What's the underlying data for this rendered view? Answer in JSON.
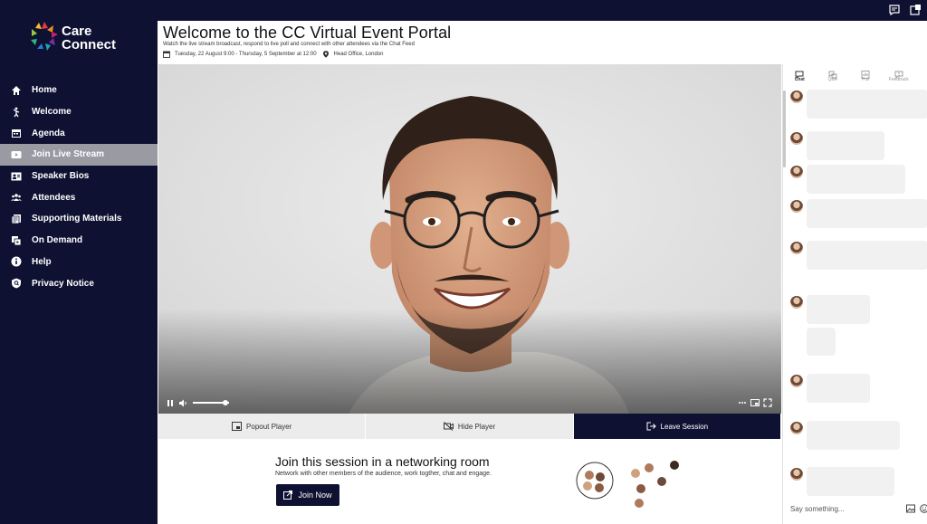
{
  "app": {
    "logo_line1": "Care",
    "logo_line2": "Connect",
    "colors": {
      "navy": "#0f1133",
      "active_nav": "#9a9aa3",
      "panel_grey": "#ececec",
      "chat_bubble": "#f1f1f1"
    }
  },
  "topbar": {
    "icons": [
      "chat-icon",
      "notification-icon"
    ]
  },
  "sidebar": {
    "items": [
      {
        "label": "Home",
        "icon": "home-icon"
      },
      {
        "label": "Welcome",
        "icon": "welcome-icon"
      },
      {
        "label": "Agenda",
        "icon": "calendar-icon"
      },
      {
        "label": "Join Live Stream",
        "icon": "play-icon",
        "active": true
      },
      {
        "label": "Speaker Bios",
        "icon": "speaker-bios-icon"
      },
      {
        "label": "Attendees",
        "icon": "attendees-icon"
      },
      {
        "label": "Supporting Materials",
        "icon": "documents-icon"
      },
      {
        "label": "On Demand",
        "icon": "on-demand-icon"
      },
      {
        "label": "Help",
        "icon": "info-icon"
      },
      {
        "label": "Privacy Notice",
        "icon": "privacy-icon"
      }
    ]
  },
  "header": {
    "title": "Welcome to the CC Virtual Event Portal",
    "subtitle": "Watch the live stream broadcast, respond to live poll and connect with other attendees via the Chat Feed",
    "date_range": "Tuesday, 22 August 9:00 - Thursday, 5 September at 12:00",
    "location": "Head Office, London"
  },
  "player": {
    "volume_level": 0.9,
    "popout_label": "Popout Player",
    "hide_label": "Hide Player",
    "leave_label": "Leave Session"
  },
  "networking": {
    "title": "Join this session in a networking room",
    "description": "Network with other members of the audience, work togther, chat and engage.",
    "join_label": "Join Now"
  },
  "chat": {
    "tabs": [
      {
        "label": "Chat",
        "icon": "chat-tab-icon",
        "active": true
      },
      {
        "label": "Q&A",
        "icon": "qa-tab-icon"
      },
      {
        "label": "Poll",
        "icon": "poll-tab-icon"
      },
      {
        "label": "Feedback",
        "icon": "feedback-tab-icon"
      }
    ],
    "input_placeholder": "Say something..."
  }
}
